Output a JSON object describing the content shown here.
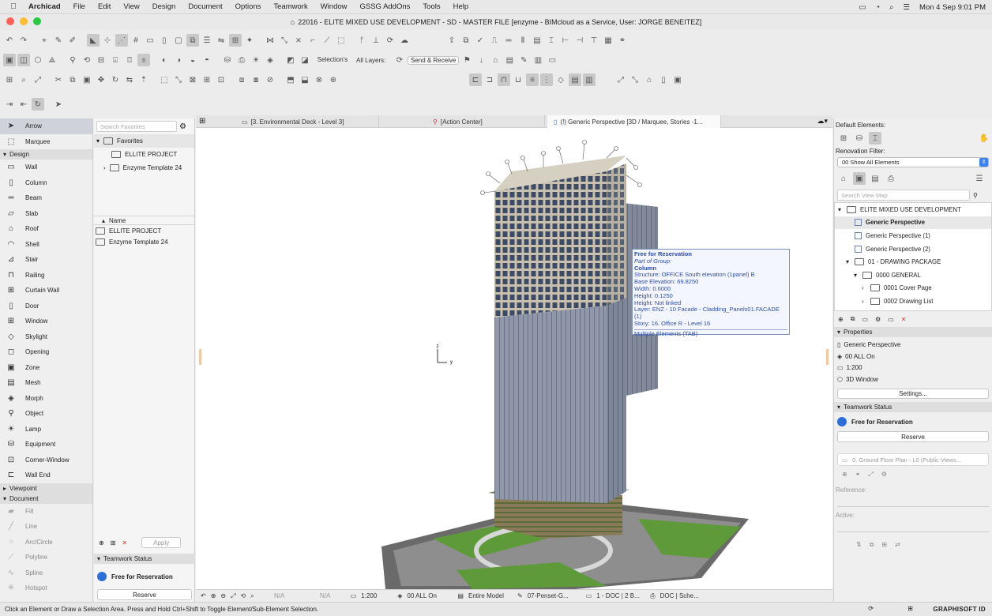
{
  "menubar": {
    "app": "Archicad",
    "items": [
      "File",
      "Edit",
      "View",
      "Design",
      "Document",
      "Options",
      "Teamwork",
      "Window",
      "GSSG AddOns",
      "Tools",
      "Help"
    ],
    "datetime": "Mon 4 Sep  9:01 PM"
  },
  "window": {
    "title": "22016 - ELITE MIXED USE DEVELOPMENT - SD - MASTER FILE [enzyme - BIMcloud as a Service, User: JORGE BENEITEZ]"
  },
  "toolbar": {
    "selections_label": "Selection's",
    "all_layers_label": "All Layers:",
    "send_receive_label": "Send & Receive"
  },
  "toolbox": {
    "arrow": "Arrow",
    "marquee": "Marquee",
    "design_section": "Design",
    "design_tools": [
      {
        "label": "Wall",
        "icon": "wall-icon"
      },
      {
        "label": "Column",
        "icon": "column-icon"
      },
      {
        "label": "Beam",
        "icon": "beam-icon"
      },
      {
        "label": "Slab",
        "icon": "slab-icon"
      },
      {
        "label": "Roof",
        "icon": "roof-icon"
      },
      {
        "label": "Shell",
        "icon": "shell-icon"
      },
      {
        "label": "Stair",
        "icon": "stair-icon"
      },
      {
        "label": "Railing",
        "icon": "railing-icon"
      },
      {
        "label": "Curtain Wall",
        "icon": "curtain-wall-icon"
      },
      {
        "label": "Door",
        "icon": "door-icon"
      },
      {
        "label": "Window",
        "icon": "window-icon"
      },
      {
        "label": "Skylight",
        "icon": "skylight-icon"
      },
      {
        "label": "Opening",
        "icon": "opening-icon"
      },
      {
        "label": "Zone",
        "icon": "zone-icon"
      },
      {
        "label": "Mesh",
        "icon": "mesh-icon"
      },
      {
        "label": "Morph",
        "icon": "morph-icon"
      },
      {
        "label": "Object",
        "icon": "object-icon"
      },
      {
        "label": "Lamp",
        "icon": "lamp-icon"
      },
      {
        "label": "Equipment",
        "icon": "equipment-icon"
      },
      {
        "label": "Corner-Window",
        "icon": "corner-window-icon"
      },
      {
        "label": "Wall End",
        "icon": "wall-end-icon"
      }
    ],
    "viewpoint_section": "Viewpoint",
    "document_section": "Document",
    "document_tools": [
      {
        "label": "Fill",
        "icon": "fill-icon"
      },
      {
        "label": "Line",
        "icon": "line-icon"
      },
      {
        "label": "Arc/Circle",
        "icon": "arc-circle-icon"
      },
      {
        "label": "Polyline",
        "icon": "polyline-icon"
      },
      {
        "label": "Spline",
        "icon": "spline-icon"
      },
      {
        "label": "Hotspot",
        "icon": "hotspot-icon"
      }
    ]
  },
  "favorites": {
    "search_placeholder": "Search Favorites",
    "root": "Favorites",
    "tree": [
      "ELLITE PROJECT",
      "Enzyme Template 24"
    ],
    "name_header": "Name",
    "list": [
      "ELLITE PROJECT",
      "Enzyme Template 24"
    ],
    "apply_label": "Apply",
    "teamwork_status": "Teamwork Status",
    "free_label": "Free for Reservation",
    "reserve_label": "Reserve"
  },
  "tabs": [
    {
      "label": "[3. Environmental Deck - Level 3]"
    },
    {
      "label": "[Action Center]"
    },
    {
      "label": "(!) Generic Perspective [3D / Marquee, Stories -1..."
    }
  ],
  "tooltip": {
    "title": "Free for Reservation",
    "group": "Part of Group:",
    "element": "Column",
    "lines": [
      "Structure: OFFICE  South elevation (1panel) B",
      "Base Elevation: 69.8250",
      "Width: 0.6000",
      "Height: 0.1250",
      "Height: Not linked",
      "Layer: ENZ - 10 Facade - Cladding_Panels01.FACADE (1)",
      "Story: 16. Office R - Level 16"
    ],
    "footer": "Multiple Elements (TAB)"
  },
  "axis": {
    "z": "z",
    "y": "y"
  },
  "bottombar": {
    "na1": "N/A",
    "na2": "N/A",
    "scale": "1:200",
    "layer_combo": "00 ALL On",
    "model": "Entire Model",
    "pen_set": "07-Penset-G...",
    "dim": "1 - DOC | 2 B...",
    "doc": "DOC | Sche..."
  },
  "statusbar": {
    "message": "Click an Element or Draw a Selection Area. Press and Hold Ctrl+Shift to Toggle Element/Sub-Element Selection.",
    "brand": "GRAPHISOFT ID"
  },
  "navigator": {
    "default_elements": "Default Elements:",
    "renovation_filter": "Renovation Filter:",
    "renovation_value": "00 Show All Elements",
    "search_placeholder": "Search View Map",
    "tree": [
      {
        "label": "ELITE MIXED USE DEVELOPMENT",
        "level": 0,
        "kind": "project"
      },
      {
        "label": "Generic Perspective",
        "level": 1,
        "kind": "view",
        "selected": true
      },
      {
        "label": "Generic Perspective (1)",
        "level": 1,
        "kind": "view"
      },
      {
        "label": "Generic Perspective (2)",
        "level": 1,
        "kind": "view"
      },
      {
        "label": "01 - DRAWING PACKAGE",
        "level": 1,
        "kind": "folder"
      },
      {
        "label": "0000 GENERAL",
        "level": 2,
        "kind": "folder"
      },
      {
        "label": "0001 Cover Page",
        "level": 3,
        "kind": "folder"
      },
      {
        "label": "0002 Drawing List",
        "level": 3,
        "kind": "folder"
      }
    ],
    "properties": "Properties",
    "prop_view": "Generic Perspective",
    "prop_layer": "00 ALL On",
    "prop_scale": "1:200",
    "prop_window": "3D Window",
    "settings": "Settings...",
    "teamwork_status": "Teamwork Status",
    "free_label": "Free for Reservation",
    "reserve_label": "Reserve",
    "layout_placeholder": "0. Ground Floor Plan - L0 (Public Views...",
    "reference": "Reference:",
    "active": "Active:"
  },
  "colors": {
    "accent": "#2d6fd8",
    "tooltip_text": "#2d4fa8",
    "tower": "#8f95a3",
    "podium_green": "#5f9a3c"
  }
}
